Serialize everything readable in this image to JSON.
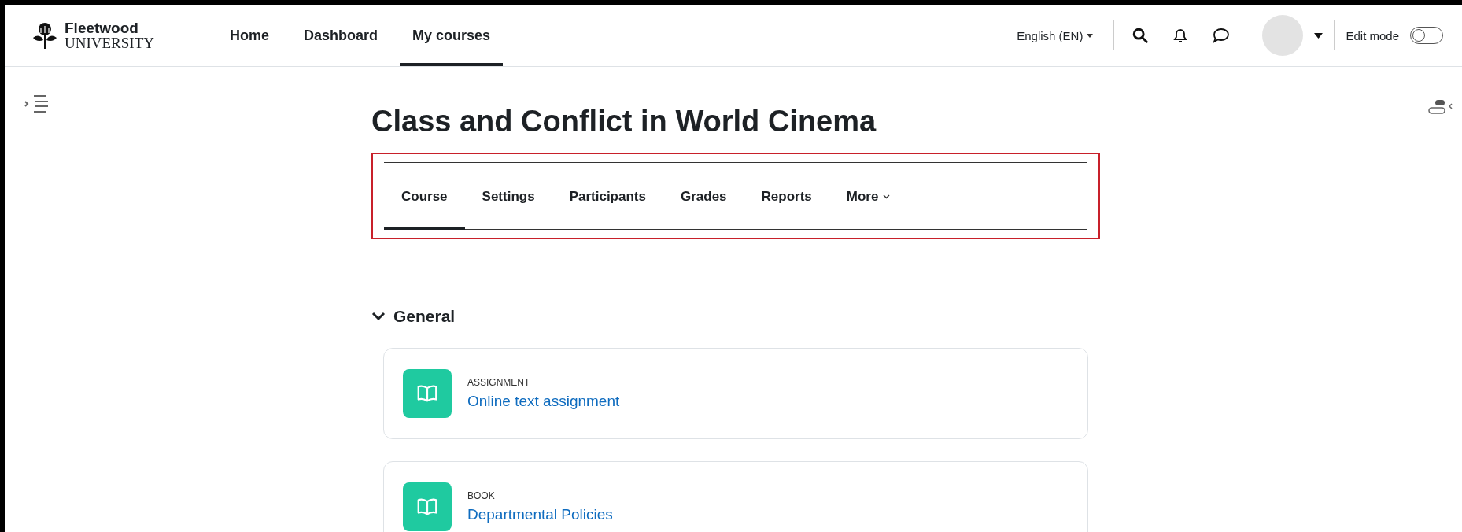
{
  "brand": {
    "name": "Fleetwood",
    "subtitle": "UNIVERSITY"
  },
  "primary_nav": [
    {
      "label": "Home",
      "selected": false
    },
    {
      "label": "Dashboard",
      "selected": false
    },
    {
      "label": "My courses",
      "selected": true
    }
  ],
  "language": "English (EN)",
  "edit_mode": {
    "label": "Edit mode",
    "on": false
  },
  "course_title": "Class and Conflict in World Cinema",
  "course_tabs": [
    {
      "label": "Course",
      "selected": true,
      "kind": "link"
    },
    {
      "label": "Settings",
      "selected": false,
      "kind": "link"
    },
    {
      "label": "Participants",
      "selected": false,
      "kind": "link"
    },
    {
      "label": "Grades",
      "selected": false,
      "kind": "link"
    },
    {
      "label": "Reports",
      "selected": false,
      "kind": "link"
    },
    {
      "label": "More",
      "selected": false,
      "kind": "menu"
    }
  ],
  "section": {
    "title": "General",
    "expanded": true,
    "activities": [
      {
        "type": "ASSIGNMENT",
        "name": "Online text assignment"
      },
      {
        "type": "BOOK",
        "name": "Departmental Policies"
      }
    ]
  }
}
